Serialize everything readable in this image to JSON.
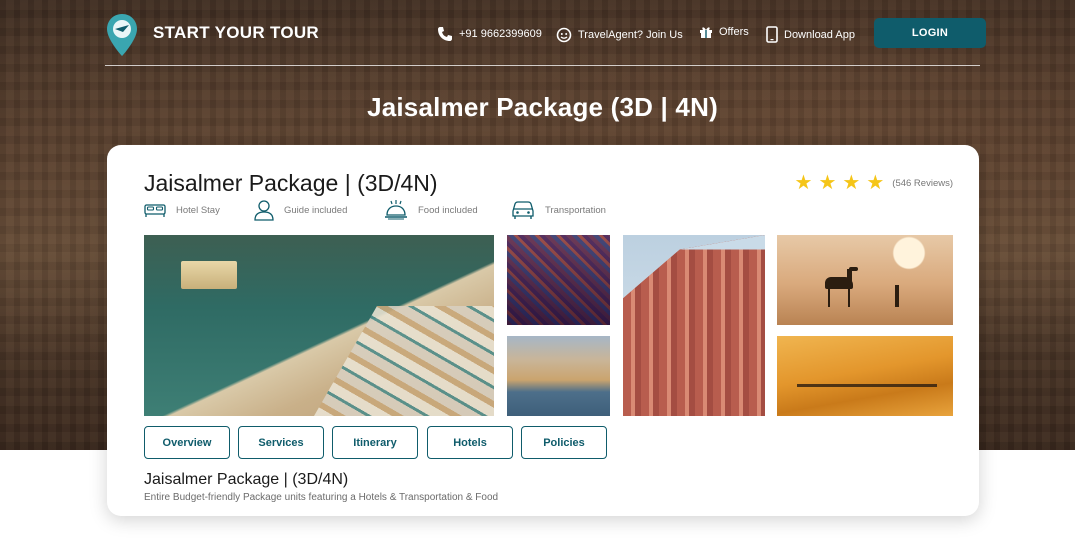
{
  "nav": {
    "brand": "START YOUR TOUR",
    "phone": "+91 9662399609",
    "travel_agent": "TravelAgent? Join Us",
    "offers": "Offers",
    "download_app": "Download App",
    "login": "LOGIN"
  },
  "hero": {
    "title": "Jaisalmer Package  (3D | 4N)"
  },
  "card": {
    "title": "Jaisalmer Package |  (3D/4N)",
    "rating_stars": 4,
    "reviews": "(546 Reviews)",
    "amenities": [
      {
        "label": "Hotel Stay",
        "icon": "bed-icon"
      },
      {
        "label": "Guide included",
        "icon": "person-icon"
      },
      {
        "label": "Food included",
        "icon": "food-tray-icon"
      },
      {
        "label": "Transportation",
        "icon": "car-icon"
      }
    ],
    "tabs": [
      "Overview",
      "Services",
      "Itinerary",
      "Hotels",
      "Policies"
    ],
    "sub_title": "Jaisalmer Package |  (3D/4N)",
    "description": "Entire Budget-friendly Package units featuring a Hotels & Transportation & Food"
  },
  "colors": {
    "accent": "#0f5c6b",
    "star": "#f5c518"
  }
}
